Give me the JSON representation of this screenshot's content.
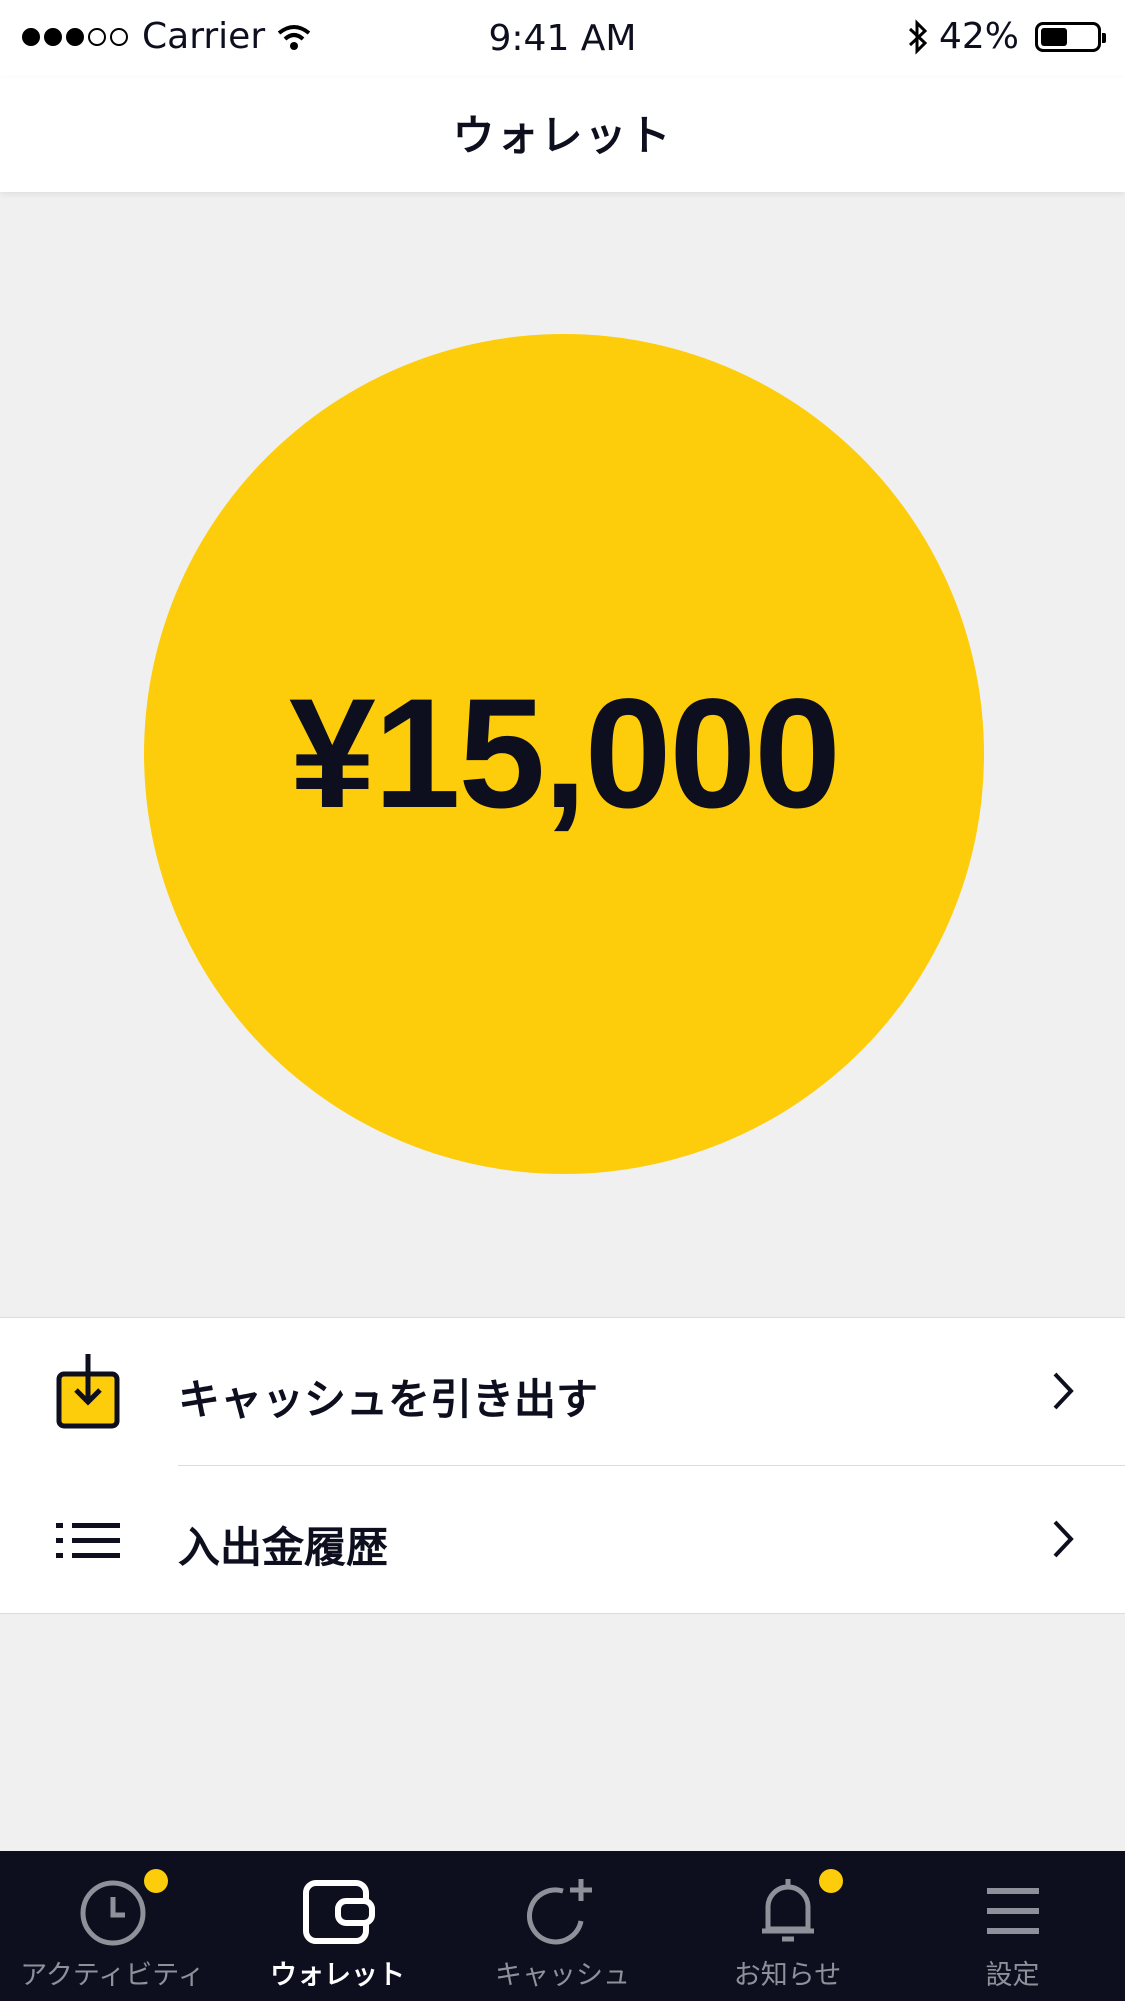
{
  "status_bar": {
    "carrier": "Carrier",
    "time": "9:41 AM",
    "battery": "42%",
    "battery_level": 0.42
  },
  "nav": {
    "title": "ウォレット"
  },
  "balance": {
    "amount": "¥15,000"
  },
  "menu": {
    "items": [
      {
        "label": "キャッシュを引き出す",
        "icon": "download-box-icon"
      },
      {
        "label": "入出金履歴",
        "icon": "list-icon"
      }
    ]
  },
  "tabbar": {
    "items": [
      {
        "label": "アクティビティ",
        "icon": "clock-icon",
        "badge": true
      },
      {
        "label": "ウォレット",
        "icon": "wallet-icon",
        "active": true
      },
      {
        "label": "キャッシュ",
        "icon": "refresh-plus-icon"
      },
      {
        "label": "お知らせ",
        "icon": "bell-icon",
        "badge": true
      },
      {
        "label": "設定",
        "icon": "menu-icon"
      }
    ]
  },
  "colors": {
    "accent": "#fdcc0a",
    "dark": "#0d0f1e",
    "background": "#f0f0f0"
  }
}
